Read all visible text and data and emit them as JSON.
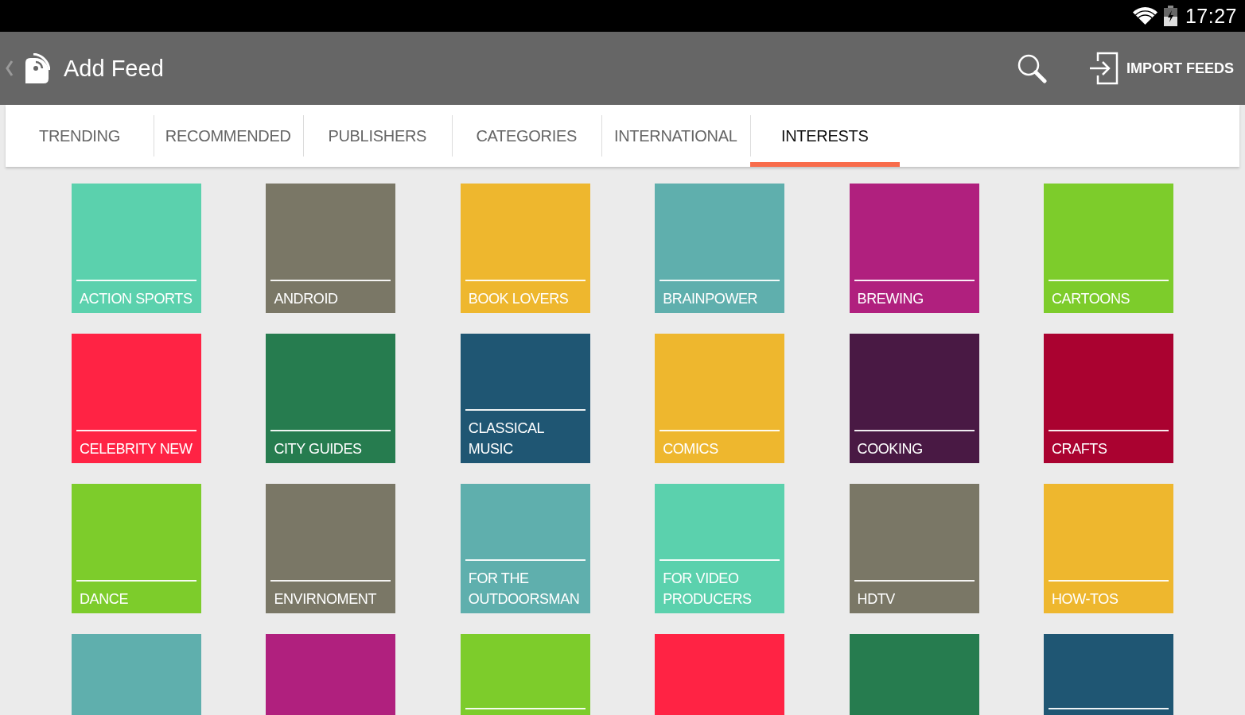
{
  "status_bar": {
    "time": "17:27"
  },
  "app_bar": {
    "title": "Add Feed",
    "action": "IMPORT FEEDS"
  },
  "tabs": [
    {
      "label": "TRENDING",
      "selected": false
    },
    {
      "label": "RECOMMENDED",
      "selected": false
    },
    {
      "label": "PUBLISHERS",
      "selected": false
    },
    {
      "label": "CATEGORIES",
      "selected": false
    },
    {
      "label": "INTERNATIONAL",
      "selected": false
    },
    {
      "label": "INTERESTS",
      "selected": true
    }
  ],
  "tiles": [
    {
      "label": "ACTION SPORTS",
      "color": "#5bd1ad",
      "divider": true
    },
    {
      "label": "ANDROID",
      "color": "#7a7766",
      "divider": true
    },
    {
      "label": "BOOK LOVERS",
      "color": "#eeb72e",
      "divider": true
    },
    {
      "label": "BRAINPOWER",
      "color": "#5fafad",
      "divider": true
    },
    {
      "label": "BREWING",
      "color": "#b0207e",
      "divider": true
    },
    {
      "label": "CARTOONS",
      "color": "#7dcc2b",
      "divider": true
    },
    {
      "label": "CELEBRITY NEW",
      "color": "#ff2344",
      "divider": true
    },
    {
      "label": "CITY GUIDES",
      "color": "#267c4f",
      "divider": true
    },
    {
      "label": "CLASSICAL MUSIC",
      "color": "#1f5673",
      "divider": true
    },
    {
      "label": "COMICS",
      "color": "#eeb72e",
      "divider": true
    },
    {
      "label": "COOKING",
      "color": "#491944",
      "divider": true
    },
    {
      "label": "CRAFTS",
      "color": "#aa0230",
      "divider": true
    },
    {
      "label": "DANCE",
      "color": "#7dcc2b",
      "divider": true
    },
    {
      "label": "ENVIRNOMENT",
      "color": "#7a7766",
      "divider": true
    },
    {
      "label": "FOR THE OUTDOORSMAN",
      "color": "#5fafad",
      "divider": true
    },
    {
      "label": "FOR VIDEO PRODUCERS",
      "color": "#5bd1ad",
      "divider": true
    },
    {
      "label": "HDTV",
      "color": "#7a7766",
      "divider": true
    },
    {
      "label": "HOW-TOS",
      "color": "#eeb72e",
      "divider": true
    },
    {
      "color": "#5fafad",
      "divider": false
    },
    {
      "color": "#b0207e",
      "divider": false
    },
    {
      "color": "#7dcc2b",
      "divider": true
    },
    {
      "color": "#ff2344",
      "divider": false
    },
    {
      "color": "#267c4f",
      "divider": false
    },
    {
      "color": "#1f5673",
      "divider": true
    }
  ]
}
